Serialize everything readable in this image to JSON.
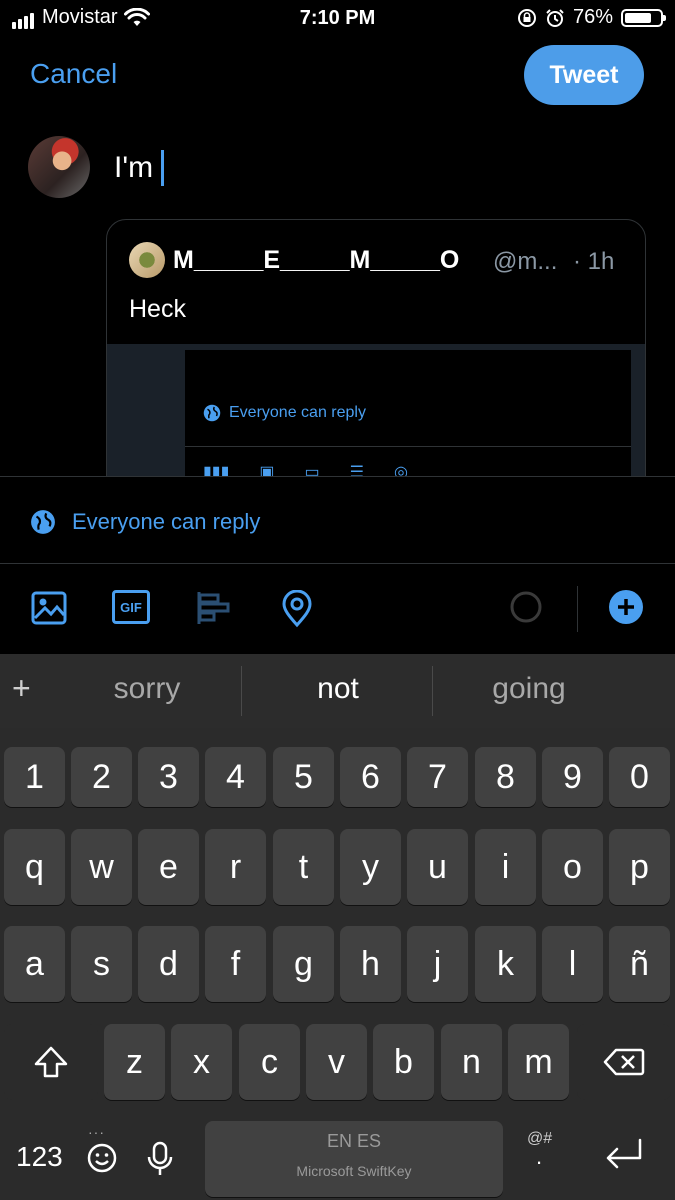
{
  "status_bar": {
    "carrier": "Movistar",
    "time": "7:10 PM",
    "battery": "76%",
    "battery_level": 0.76
  },
  "header": {
    "cancel_label": "Cancel",
    "tweet_label": "Tweet"
  },
  "compose": {
    "text": "I'm"
  },
  "quoted_tweet": {
    "name": "M_____E_____M_____O",
    "handle": "@m...",
    "time": "· 1h",
    "text": "Heck",
    "embedded_reply_label": "Everyone can reply"
  },
  "reply_setting": {
    "label": "Everyone can reply"
  },
  "toolbar": {
    "icons": [
      "image-icon",
      "gif-icon",
      "poll-icon",
      "location-icon",
      "progress-ring-icon",
      "add-thread-icon"
    ],
    "gif_label": "GIF"
  },
  "keyboard": {
    "suggestions": [
      "sorry",
      "not",
      "going"
    ],
    "plus_label": "+",
    "row_numbers": [
      "1",
      "2",
      "3",
      "4",
      "5",
      "6",
      "7",
      "8",
      "9",
      "0"
    ],
    "row_top": [
      "q",
      "w",
      "e",
      "r",
      "t",
      "y",
      "u",
      "i",
      "o",
      "p"
    ],
    "row_middle": [
      "a",
      "s",
      "d",
      "f",
      "g",
      "h",
      "j",
      "k",
      "l",
      "ñ"
    ],
    "row_bottom": [
      "z",
      "x",
      "c",
      "v",
      "b",
      "n",
      "m"
    ],
    "numbers_label": "123",
    "space_language": "EN ES",
    "space_brand": "Microsoft SwiftKey",
    "symbols_label": "@#",
    "dot_label": "."
  },
  "colors": {
    "accent": "#4a9ff0",
    "tweet_button": "#4d9de9",
    "keyboard_bg": "#2b2b2b",
    "key_bg": "#414141"
  }
}
